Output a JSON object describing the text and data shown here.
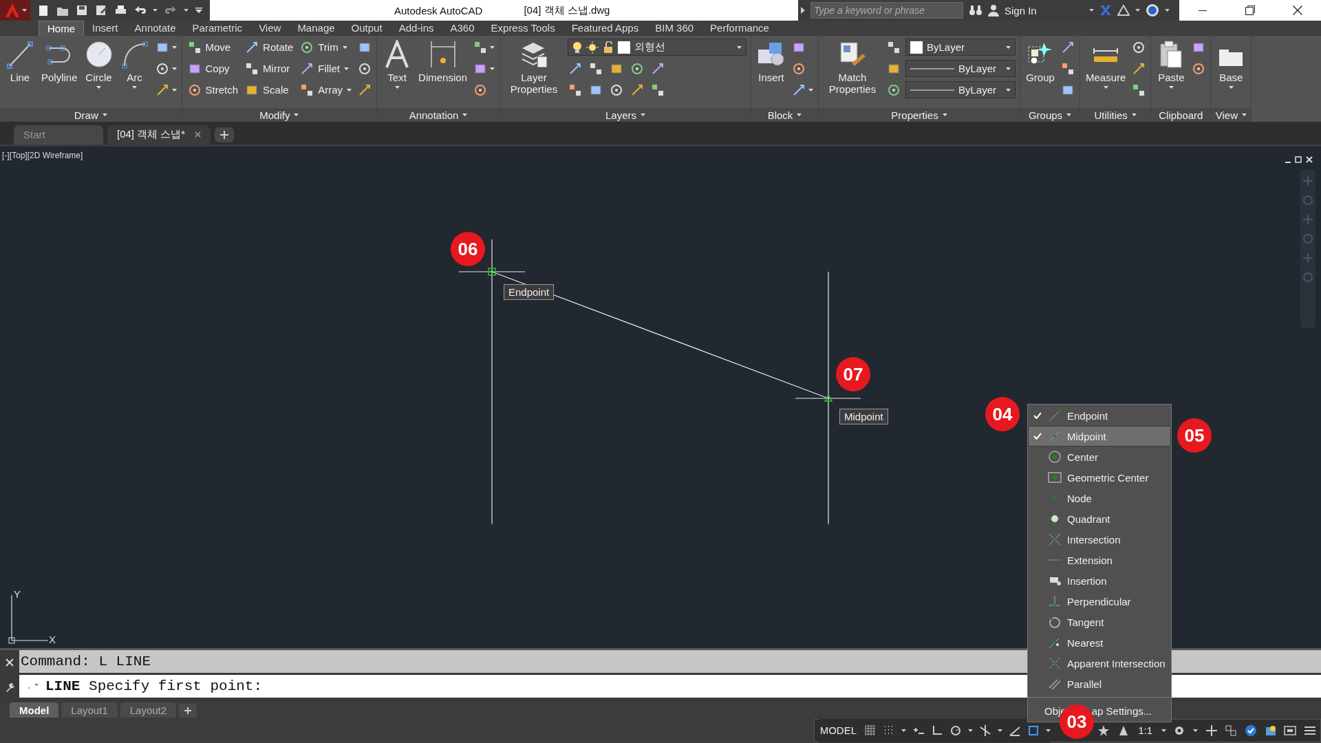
{
  "title_bar": {
    "app_title": "Autodesk AutoCAD",
    "file_title": "[04] 객체 스냅.dwg",
    "search": {
      "placeholder": "Type a keyword or phrase"
    },
    "sign_in": "Sign In"
  },
  "ribbon_tabs": [
    {
      "label": "Home",
      "selected": true
    },
    {
      "label": "Insert",
      "selected": false
    },
    {
      "label": "Annotate",
      "selected": false
    },
    {
      "label": "Parametric",
      "selected": false
    },
    {
      "label": "View",
      "selected": false
    },
    {
      "label": "Manage",
      "selected": false
    },
    {
      "label": "Output",
      "selected": false
    },
    {
      "label": "Add-ins",
      "selected": false
    },
    {
      "label": "A360",
      "selected": false
    },
    {
      "label": "Express Tools",
      "selected": false
    },
    {
      "label": "Featured Apps",
      "selected": false
    },
    {
      "label": "BIM 360",
      "selected": false
    },
    {
      "label": "Performance",
      "selected": false
    }
  ],
  "ribbon_panels": [
    {
      "title": "Draw",
      "has_menu": true,
      "columns": [
        [
          {
            "kind": "large",
            "label": "Line",
            "dropdown": false
          }
        ],
        [
          {
            "kind": "large",
            "label": "Polyline",
            "dropdown": false
          }
        ],
        [
          {
            "kind": "large",
            "label": "Circle",
            "dropdown": true
          }
        ],
        [
          {
            "kind": "large",
            "label": "Arc",
            "dropdown": true
          }
        ],
        [
          {
            "kind": "tool",
            "dropdown": true
          },
          {
            "kind": "tool",
            "dropdown": true
          },
          {
            "kind": "tool",
            "dropdown": true
          }
        ]
      ]
    },
    {
      "title": "Modify",
      "has_menu": true,
      "columns": [
        [
          {
            "kind": "small",
            "label": "Move",
            "dropdown": false
          },
          {
            "kind": "small",
            "label": "Copy",
            "dropdown": false
          },
          {
            "kind": "small",
            "label": "Stretch",
            "dropdown": false
          }
        ],
        [
          {
            "kind": "small",
            "label": "Rotate",
            "dropdown": false
          },
          {
            "kind": "small",
            "label": "Mirror",
            "dropdown": false
          },
          {
            "kind": "small",
            "label": "Scale",
            "dropdown": false
          }
        ],
        [
          {
            "kind": "small",
            "label": "Trim",
            "dropdown": true
          },
          {
            "kind": "small",
            "label": "Fillet",
            "dropdown": true
          },
          {
            "kind": "small",
            "label": "Array",
            "dropdown": true
          }
        ],
        [
          {
            "kind": "tool",
            "dropdown": false
          },
          {
            "kind": "tool",
            "dropdown": false
          },
          {
            "kind": "tool",
            "dropdown": false
          }
        ]
      ]
    },
    {
      "title": "Annotation",
      "has_menu": true,
      "columns": [
        [
          {
            "kind": "large",
            "label": "Text",
            "dropdown": true
          }
        ],
        [
          {
            "kind": "large",
            "label": "Dimension",
            "dropdown": false
          }
        ],
        [
          {
            "kind": "tool",
            "dropdown": true
          },
          {
            "kind": "tool",
            "dropdown": true
          },
          {
            "kind": "tool",
            "dropdown": false
          }
        ]
      ]
    },
    {
      "title": "Layers",
      "has_menu": true,
      "columns": [
        [
          {
            "kind": "large",
            "label": "Layer Properties",
            "dropdown": false
          }
        ],
        [
          {
            "kind": "layer-combo",
            "value": "외형선"
          },
          {
            "kind": "tool-row"
          },
          {
            "kind": "tool-row"
          }
        ]
      ]
    },
    {
      "title": "Block",
      "has_menu": true,
      "columns": [
        [
          {
            "kind": "large",
            "label": "Insert",
            "dropdown": false
          }
        ],
        [
          {
            "kind": "tool",
            "dropdown": false
          },
          {
            "kind": "tool",
            "dropdown": false
          },
          {
            "kind": "tool",
            "dropdown": true
          }
        ]
      ]
    },
    {
      "title": "Properties",
      "has_menu": true,
      "columns": [
        [
          {
            "kind": "large",
            "label": "Match Properties",
            "dropdown": false
          }
        ],
        [
          {
            "kind": "tool",
            "dropdown": false
          },
          {
            "kind": "tool",
            "dropdown": false
          },
          {
            "kind": "tool",
            "dropdown": false
          }
        ],
        [
          {
            "kind": "color-combo",
            "value": "ByLayer"
          },
          {
            "kind": "line-combo",
            "value": "ByLayer"
          },
          {
            "kind": "line-combo",
            "value": "ByLayer"
          }
        ]
      ]
    },
    {
      "title": "Groups",
      "has_menu": true,
      "columns": [
        [
          {
            "kind": "large",
            "label": "Group",
            "dropdown": false
          }
        ],
        [
          {
            "kind": "tool",
            "dropdown": false
          },
          {
            "kind": "tool",
            "dropdown": false
          },
          {
            "kind": "tool",
            "dropdown": false
          }
        ]
      ]
    },
    {
      "title": "Utilities",
      "has_menu": true,
      "columns": [
        [
          {
            "kind": "large",
            "label": "Measure",
            "dropdown": true
          }
        ],
        [
          {
            "kind": "tool",
            "dropdown": false
          },
          {
            "kind": "tool",
            "dropdown": false
          },
          {
            "kind": "tool",
            "dropdown": false
          }
        ]
      ]
    },
    {
      "title": "Clipboard",
      "has_menu": false,
      "columns": [
        [
          {
            "kind": "large",
            "label": "Paste",
            "dropdown": true
          }
        ],
        [
          {
            "kind": "tool",
            "dropdown": false
          },
          {
            "kind": "tool",
            "dropdown": false
          }
        ]
      ]
    },
    {
      "title": "View",
      "has_menu": true,
      "columns": [
        [
          {
            "kind": "large",
            "label": "Base",
            "dropdown": true
          }
        ]
      ]
    }
  ],
  "document_tabs": [
    {
      "label": "Start",
      "selected": false
    },
    {
      "label": "[04] 객체 스냅*",
      "selected": true
    }
  ],
  "viewport": {
    "label": "[-][Top][2D Wireframe]",
    "tooltips": [
      "Endpoint",
      "Midpoint"
    ],
    "ucs": {
      "y_label": "Y",
      "x_label": "X"
    }
  },
  "callouts": [
    "06",
    "07",
    "04",
    "05",
    "03"
  ],
  "snap_menu": {
    "items": [
      {
        "label": "Endpoint",
        "checked": true,
        "selected": false
      },
      {
        "label": "Midpoint",
        "checked": true,
        "selected": true
      },
      {
        "label": "Center",
        "checked": false,
        "selected": false
      },
      {
        "label": "Geometric Center",
        "checked": false,
        "selected": false
      },
      {
        "label": "Node",
        "checked": false,
        "selected": false
      },
      {
        "label": "Quadrant",
        "checked": false,
        "selected": false
      },
      {
        "label": "Intersection",
        "checked": false,
        "selected": false
      },
      {
        "label": "Extension",
        "checked": false,
        "selected": false
      },
      {
        "label": "Insertion",
        "checked": false,
        "selected": false
      },
      {
        "label": "Perpendicular",
        "checked": false,
        "selected": false
      },
      {
        "label": "Tangent",
        "checked": false,
        "selected": false
      },
      {
        "label": "Nearest",
        "checked": false,
        "selected": false
      },
      {
        "label": "Apparent Intersection",
        "checked": false,
        "selected": false
      },
      {
        "label": "Parallel",
        "checked": false,
        "selected": false
      }
    ],
    "footer_parts": [
      "Obje",
      "ap Settings..."
    ]
  },
  "command_line": {
    "history": "Command: L LINE",
    "prompt": "**LINE** Specify first point:"
  },
  "layout_tabs": [
    {
      "label": "Model",
      "selected": true
    },
    {
      "label": "Layout1",
      "selected": false
    },
    {
      "label": "Layout2",
      "selected": false
    }
  ],
  "status_bar": {
    "space": "MODEL",
    "scale": "1:1"
  }
}
